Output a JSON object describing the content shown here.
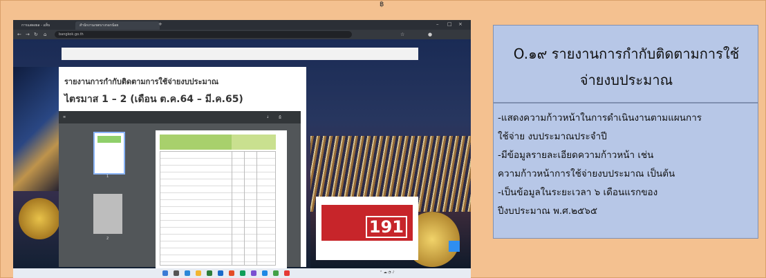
{
  "slide": {
    "top_marker": "฿"
  },
  "browser": {
    "tabs": [
      "การแสดงผล - แท็บ",
      "สำนักงานเขตบางกอกน้อย"
    ],
    "url": "bangkok.go.th"
  },
  "page": {
    "search_placeholder": "",
    "heading_line1": "รายงานการกำกับติดตามการใช้จ่ายงบประมาณ",
    "heading_line2": "ไตรมาส 1 – 2 (เดือน ต.ค.64 – มี.ค.65)",
    "pdf_page_numbers": [
      "1",
      "2"
    ],
    "ad_number": "191"
  },
  "info": {
    "title_line1": "O.๑๙ รายงานการกำกับติดตามการใช้",
    "title_line2": "จ่ายงบประมาณ",
    "lines": [
      "-แสดงความก้าวหน้าในการดำเนินงานตามแผนการ",
      "ใช้จ่าย งบประมาณประจำปี",
      "-มีข้อมูลรายละเอียดความก้าวหน้า เช่น",
      "ความก้าวหน้าการใช้จ่ายงบประมาณ เป็นต้น",
      "-เป็นข้อมูลในระยะเวลา ๖ เดือนแรกของ",
      "ปีงบประมาณ พ.ศ.๒๕๖๕"
    ]
  },
  "colors": {
    "slide_bg": "#f4c190",
    "box_bg": "#b7c7e7",
    "ad_red": "#c7252a"
  }
}
